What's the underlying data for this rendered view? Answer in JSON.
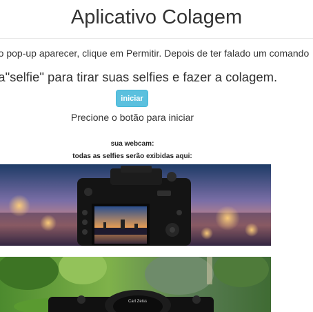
{
  "header": {
    "title": "Aplicativo Colagem"
  },
  "instructions": "e o pop-up aparecer, clique em Permitir. Depois de ter falado um comando",
  "say_text": "ga\"selfie\" para tirar suas selfies e fazer a colagem.",
  "start_button": {
    "label": "iniciar"
  },
  "press_text": "Precione o botão para iniciar",
  "webcam_label": "sua webcam:",
  "selfies_label": "todas as selfies serão exibidas aqui:",
  "images": [
    {
      "icon": "dslr-camera-sunset-photo"
    },
    {
      "icon": "camera-lens-in-garden-photo",
      "lens_text": "Carl Zeiss"
    }
  ],
  "colors": {
    "button": "#5bc0de",
    "button_border": "#46b8da",
    "text": "#333333"
  }
}
